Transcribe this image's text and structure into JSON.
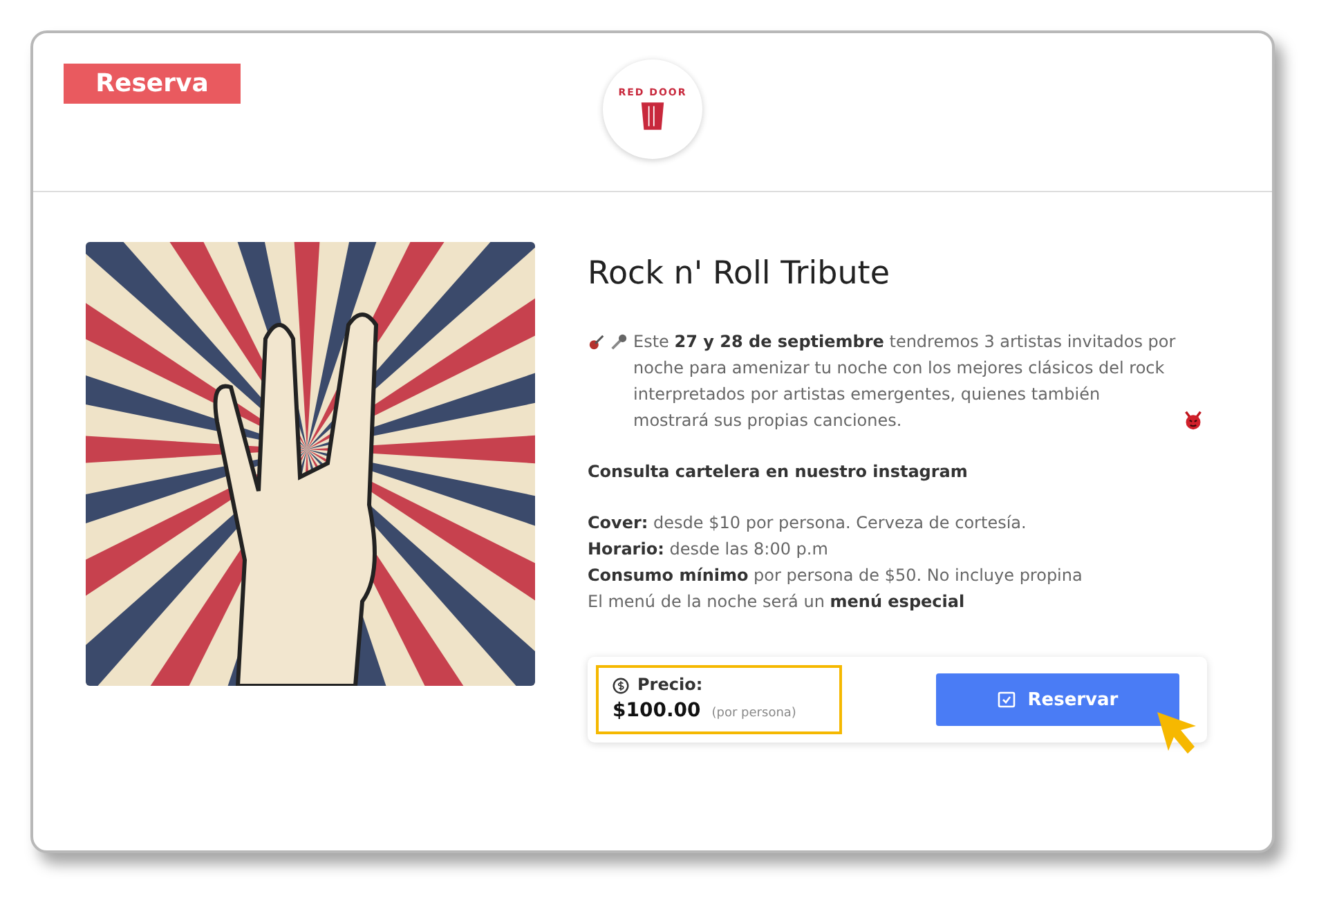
{
  "header": {
    "badge": "Reserva",
    "logo_text": "RED DOOR"
  },
  "event": {
    "title": "Rock n' Roll Tribute",
    "description": "Este **27 y 28 de septiembre** tendremos 3 artistas invitados por noche para amenizar tu noche con los mejores clásicos del rock interpretados por artistas emergentes, quienes también mostrará sus propias canciones.",
    "note": "Consulta cartelera en nuestro instagram",
    "details": [
      "**Cover:** desde $10 por persona. Cerveza de cortesía.",
      "**Horario:** desde las 8:00 p.m",
      "**Consumo mínimo** por persona de $50. No incluye propina",
      "El menú de la noche será un **menú especial**"
    ]
  },
  "booking": {
    "price_label": "Precio:",
    "price": "$100.00",
    "price_unit": "(por persona)",
    "button": "Reservar"
  }
}
